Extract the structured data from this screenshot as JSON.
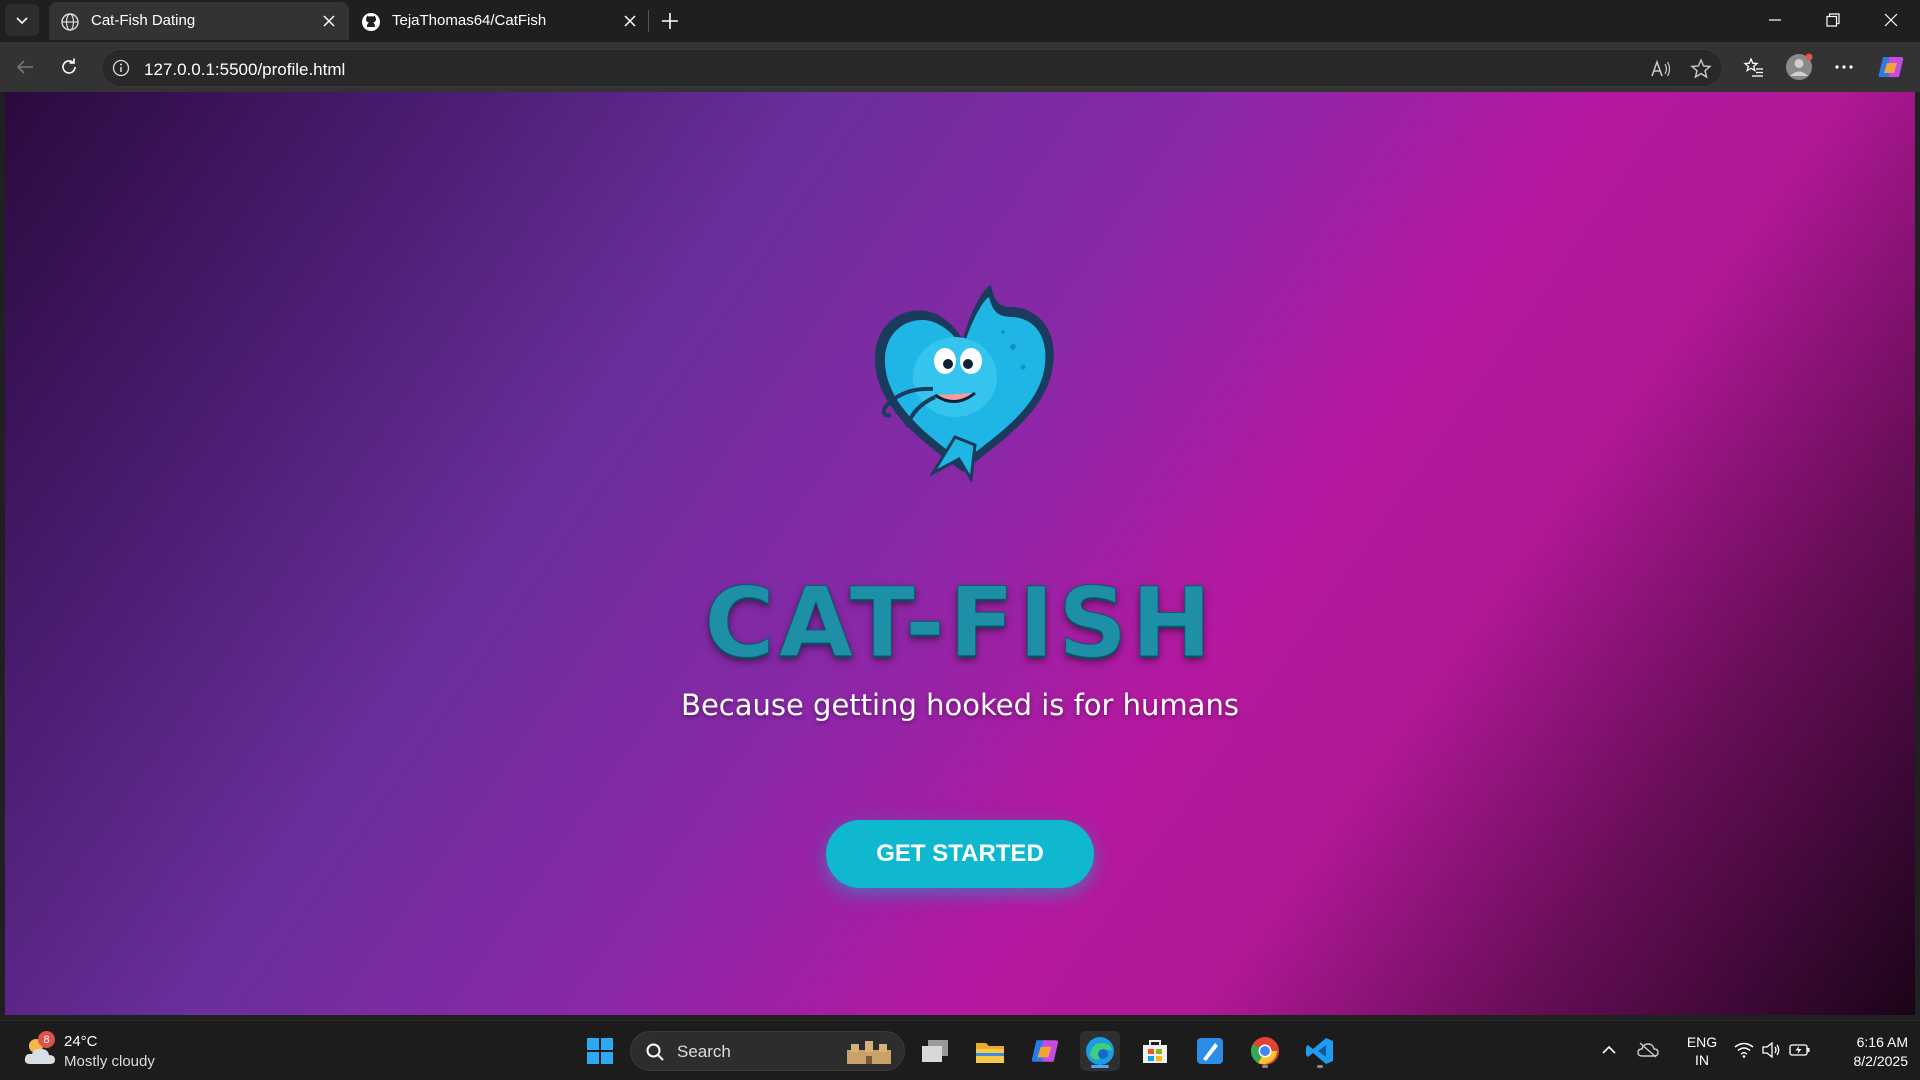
{
  "browser": {
    "tabs": [
      {
        "title": "Cat-Fish Dating",
        "icon": "globe-icon",
        "active": true
      },
      {
        "title": "TejaThomas64/CatFish",
        "icon": "github-icon",
        "active": false
      }
    ],
    "address_url": "127.0.0.1:5500/profile.html"
  },
  "page": {
    "brand_title": "CAT-FISH",
    "tagline": "Because getting hooked is for humans",
    "cta_label": "GET STARTED",
    "colors": {
      "accent": "#0fb8cf",
      "brand_text": "#1d8fa6",
      "logo_blue": "#1fb6e6"
    }
  },
  "taskbar": {
    "weather": {
      "badge": "8",
      "temp": "24°C",
      "desc": "Mostly cloudy"
    },
    "search_label": "Search",
    "lang_line1": "ENG",
    "lang_line2": "IN",
    "time": "6:16 AM",
    "date": "8/2/2025"
  }
}
